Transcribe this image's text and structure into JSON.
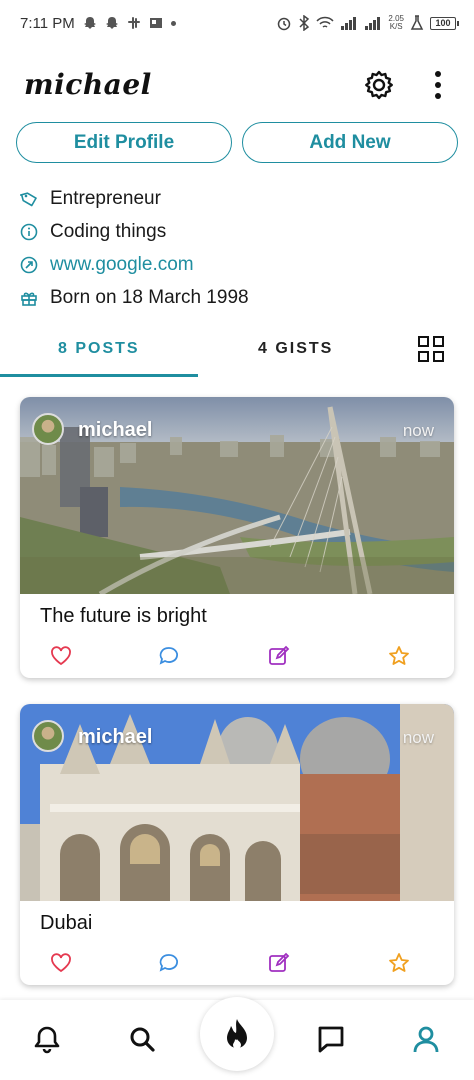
{
  "status_bar": {
    "time": "7:11 PM",
    "network_speed_top": "2.05",
    "network_speed_unit": "K/S",
    "battery": "100"
  },
  "header": {
    "username": "michael",
    "icons": [
      "gear-icon",
      "more-vert-icon"
    ]
  },
  "profile_actions": {
    "edit_label": "Edit Profile",
    "add_label": "Add New"
  },
  "profile_info": {
    "occupation": "Entrepreneur",
    "bio": "Coding things",
    "website": "www.google.com",
    "birthday": "Born on 18 March 1998"
  },
  "tabs": {
    "posts_label": "8 POSTS",
    "gists_label": "4 GISTS",
    "active": "posts"
  },
  "posts": [
    {
      "author": "michael",
      "time": "now",
      "caption": "The future is bright"
    },
    {
      "author": "michael",
      "time": "now",
      "caption": "Dubai"
    }
  ],
  "colors": {
    "accent": "#1f8ea0",
    "like": "#e53950",
    "comment": "#3b8ee0",
    "edit": "#a030c0",
    "star": "#f0a020"
  },
  "bottom_nav": {
    "items": [
      "bell-icon",
      "search-icon",
      "fire-icon",
      "chat-icon",
      "profile-icon"
    ],
    "active": "profile-icon"
  }
}
